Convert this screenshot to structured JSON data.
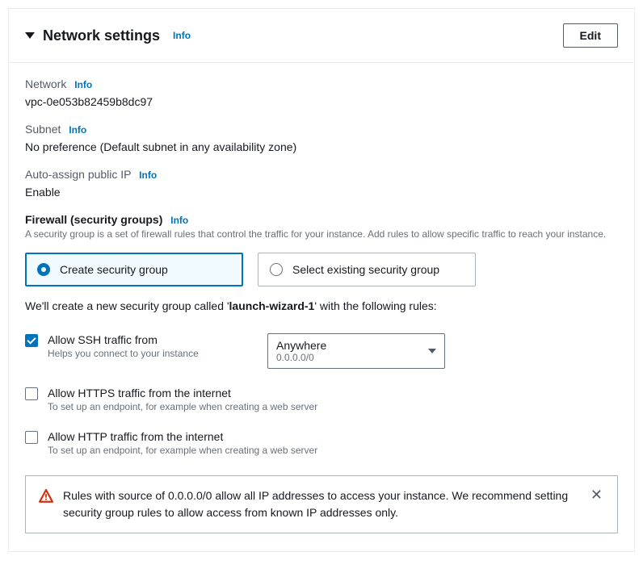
{
  "header": {
    "title": "Network settings",
    "info": "Info",
    "edit": "Edit"
  },
  "network": {
    "label": "Network",
    "info": "Info",
    "value": "vpc-0e053b82459b8dc97"
  },
  "subnet": {
    "label": "Subnet",
    "info": "Info",
    "value": "No preference (Default subnet in any availability zone)"
  },
  "publicIp": {
    "label": "Auto-assign public IP",
    "info": "Info",
    "value": "Enable"
  },
  "firewall": {
    "label": "Firewall (security groups)",
    "info": "Info",
    "desc": "A security group is a set of firewall rules that control the traffic for your instance. Add rules to allow specific traffic to reach your instance.",
    "option_create": "Create security group",
    "option_existing": "Select existing security group",
    "create_msg_prefix": "We'll create a new security group called '",
    "create_msg_name": "launch-wizard-1",
    "create_msg_suffix": "' with the following rules:"
  },
  "ssh": {
    "label": "Allow SSH traffic from",
    "desc": "Helps you connect to your instance",
    "dropdown_main": "Anywhere",
    "dropdown_sub": "0.0.0.0/0"
  },
  "https": {
    "label": "Allow HTTPS traffic from the internet",
    "desc": "To set up an endpoint, for example when creating a web server"
  },
  "http": {
    "label": "Allow HTTP traffic from the internet",
    "desc": "To set up an endpoint, for example when creating a web server"
  },
  "alert": {
    "text": "Rules with source of 0.0.0.0/0 allow all IP addresses to access your instance. We recommend setting security group rules to allow access from known IP addresses only."
  }
}
